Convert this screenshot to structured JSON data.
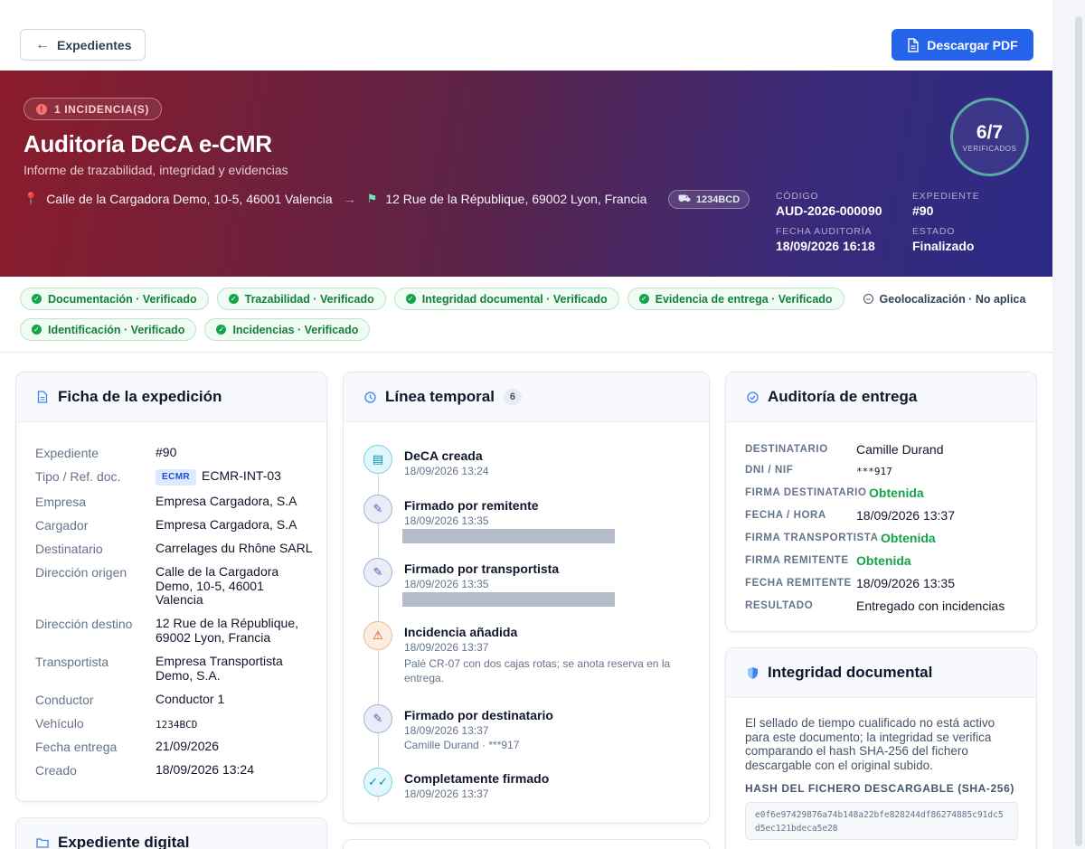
{
  "topbar": {
    "back_label": "Expedientes",
    "pdf_label": "Descargar PDF"
  },
  "hero": {
    "incidents_badge": "1 INCIDENCIA(S)",
    "title": "Auditoría DeCA e-CMR",
    "subtitle": "Informe de trazabilidad, integridad y evidencias",
    "origin": "Calle de la Cargadora Demo, 10-5, 46001 Valencia",
    "destination": "12 Rue de la République, 69002 Lyon, Francia",
    "plate": "1234BCD",
    "meta": {
      "codigo_label": "CÓDIGO",
      "codigo": "AUD-2026-000090",
      "expediente_label": "EXPEDIENTE",
      "expediente": "#90",
      "fecha_label": "FECHA AUDITORÍA",
      "fecha": "18/09/2026 16:18",
      "estado_label": "ESTADO",
      "estado": "Finalizado"
    },
    "score": {
      "value": "6/7",
      "label": "VERIFICADOS"
    }
  },
  "checks": [
    {
      "label": "Documentación · Verificado",
      "status": "ok"
    },
    {
      "label": "Trazabilidad · Verificado",
      "status": "ok"
    },
    {
      "label": "Integridad documental · Verificado",
      "status": "ok"
    },
    {
      "label": "Evidencia de entrega · Verificado",
      "status": "ok"
    },
    {
      "label": "Geolocalización · No aplica",
      "status": "na"
    },
    {
      "label": "Identificación · Verificado",
      "status": "ok"
    },
    {
      "label": "Incidencias · Verificado",
      "status": "ok"
    }
  ],
  "ficha": {
    "title": "Ficha de la expedición",
    "rows": [
      {
        "k": "Expediente",
        "v": "#90"
      },
      {
        "k": "Tipo / Ref. doc.",
        "tag": "ECMR",
        "v": "ECMR-INT-03"
      },
      {
        "k": "Empresa",
        "v": "Empresa Cargadora, S.A"
      },
      {
        "k": "Cargador",
        "v": "Empresa Cargadora, S.A"
      },
      {
        "k": "Destinatario",
        "v": "Carrelages du Rhône SARL"
      },
      {
        "k": "Dirección origen",
        "v": "Calle de la Cargadora Demo, 10-5, 46001 Valencia"
      },
      {
        "k": "Dirección destino",
        "v": "12 Rue de la République, 69002 Lyon, Francia"
      },
      {
        "k": "Transportista",
        "v": "Empresa Transportista Demo, S.A."
      },
      {
        "k": "Conductor",
        "v": "Conductor 1"
      },
      {
        "k": "Vehículo",
        "v": "1234BCD"
      },
      {
        "k": "Fecha entrega",
        "v": "21/09/2026"
      },
      {
        "k": "Creado",
        "v": "18/09/2026 13:24"
      }
    ]
  },
  "expediente_digital": {
    "title": "Expediente digital"
  },
  "timeline": {
    "title": "Línea temporal",
    "count": "6",
    "items": [
      {
        "title": "DeCA creada",
        "date": "18/09/2026 13:24"
      },
      {
        "title": "Firmado por remitente",
        "date": "18/09/2026 13:35"
      },
      {
        "title": "Firmado por transportista",
        "date": "18/09/2026 13:35"
      },
      {
        "title": "Incidencia añadida",
        "date": "18/09/2026 13:37",
        "extra": "Palé CR-07 con dos cajas rotas; se anota reserva en la entrega."
      },
      {
        "title": "Firmado por destinatario",
        "date": "18/09/2026 13:37",
        "extra": "Camille Durand · ***917"
      },
      {
        "title": "Completamente firmado",
        "date": "18/09/2026 13:37"
      }
    ]
  },
  "entrega": {
    "title": "Auditoría de entrega",
    "rows": [
      {
        "k": "DESTINATARIO",
        "v": "Camille Durand"
      },
      {
        "k": "DNI / NIF",
        "v": "***917"
      },
      {
        "k": "FIRMA DESTINATARIO",
        "v": "Obtenida"
      },
      {
        "k": "FECHA / HORA",
        "v": "18/09/2026 13:37"
      },
      {
        "k": "FIRMA TRANSPORTISTA",
        "v": "Obtenida"
      },
      {
        "k": "FIRMA REMITENTE",
        "v": "Obtenida"
      },
      {
        "k": "FECHA REMITENTE",
        "v": "18/09/2026 13:35"
      },
      {
        "k": "RESULTADO",
        "v": "Entregado con incidencias"
      }
    ]
  },
  "integridad": {
    "title": "Integridad documental",
    "text": "El sellado de tiempo cualificado no está activo para este documento; la integridad se verifica comparando el hash SHA-256 del fichero descargable con el original subido.",
    "hash_label": "HASH DEL FICHERO DESCARGABLE (SHA-256)",
    "hash": "e0f6e97429876a74b148a22bfe828244df86274885c91dc5d5ec121bdeca5e28"
  },
  "colors": {
    "accent": "#2563eb",
    "success": "#16a34a",
    "warning": "#c2410c"
  }
}
